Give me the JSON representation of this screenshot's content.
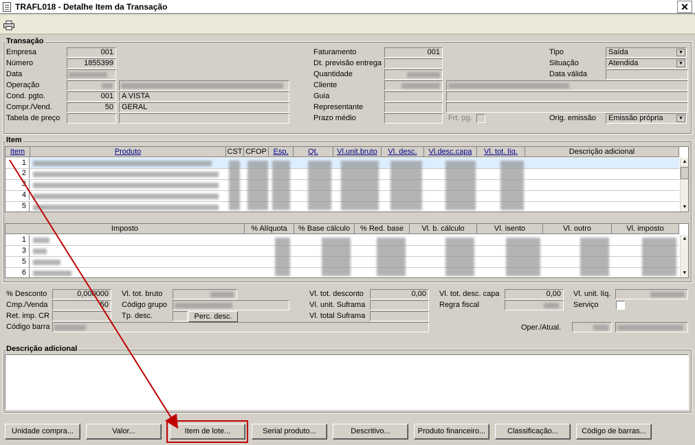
{
  "window": {
    "title": "TRAFL018 - Detalhe Item da Transação",
    "close_glyph": "✕"
  },
  "transacao": {
    "legend": "Transação",
    "empresa_label": "Empresa",
    "empresa": "001",
    "numero_label": "Número",
    "numero": "1855399",
    "data_label": "Data",
    "operacao_label": "Operação",
    "cond_pgto_label": "Cond. pgto.",
    "cond_pgto_code": "001",
    "cond_pgto_desc": "A VISTA",
    "compr_vend_label": "Compr./Vend.",
    "compr_vend_code": "50",
    "compr_vend_desc": "GERAL",
    "tabela_preco_label": "Tabela de preço",
    "faturamento_label": "Faturamento",
    "faturamento": "001",
    "dt_previsao_label": "Dt. previsão entrega",
    "quantidade_label": "Quantidade",
    "cliente_label": "Cliente",
    "guia_label": "Guia",
    "representante_label": "Representante",
    "prazo_medio_label": "Prazo médio",
    "frt_pg_label": "Frt. pg.",
    "tipo_label": "Tipo",
    "tipo": "Saída",
    "situacao_label": "Situação",
    "situacao": "Atendida",
    "data_valida_label": "Data válida",
    "orig_emissao_label": "Orig. emissão",
    "orig_emissao": "Emissão própria"
  },
  "item": {
    "legend": "Item",
    "columns": [
      "Item",
      "Produto",
      "CST",
      "CFOP",
      "Esp.",
      "Qt.",
      "Vl.unit.bruto",
      "Vl. desc.",
      "Vl.desc.capa",
      "Vl. tot. líq.",
      "Descrição adicional"
    ],
    "rows": [
      "1",
      "2",
      "3",
      "4",
      "5"
    ]
  },
  "imposto": {
    "columns": [
      "Imposto",
      "% Alíquota",
      "% Base cálculo",
      "% Red. base",
      "Vl. b. cálculo",
      "Vl. isento",
      "Vl. outro",
      "Vl. imposto"
    ],
    "rows": [
      "1",
      "3",
      "5",
      "6"
    ]
  },
  "totais": {
    "desconto_label": "% Desconto",
    "desconto": "0,000000",
    "cmp_venda_label": "Cmp./Venda",
    "cmp_venda": "50",
    "ret_imp_label": "Ret. imp. CR",
    "codigo_barra_label": "Código barra",
    "vl_tot_bruto_label": "Vl. tot. bruto",
    "codigo_grupo_label": "Código grupo",
    "tp_desc_label": "Tp. desc.",
    "perc_desc_button": "Perc. desc.",
    "vl_tot_desconto_label": "Vl. tot. desconto",
    "vl_tot_desconto": "0,00",
    "vl_unit_suframa_label": "Vl. unit. Suframa",
    "vl_total_suframa_label": "Vl. total Suframa",
    "vl_tot_desc_capa_label": "Vl. tot. desc. capa",
    "vl_tot_desc_capa": "0,00",
    "regra_fiscal_label": "Regra fiscal",
    "vl_unit_liq_label": "Vl. unit. líq.",
    "servico_label": "Serviço",
    "oper_atual_label": "Oper./Atual."
  },
  "descricao": {
    "legend": "Descrição adicional"
  },
  "buttons": {
    "unidade_compra": "Unidade compra...",
    "valor": "Valor...",
    "item_lote": "Item de lote...",
    "serial_produto": "Serial produto...",
    "descritivo": "Descritivo...",
    "produto_financeiro": "Produto financeiro...",
    "classificacao": "Classificação...",
    "codigo_barras": "Código de barras..."
  },
  "colors": {
    "annotation": "#c00000",
    "selected_row": "#dceeff"
  }
}
